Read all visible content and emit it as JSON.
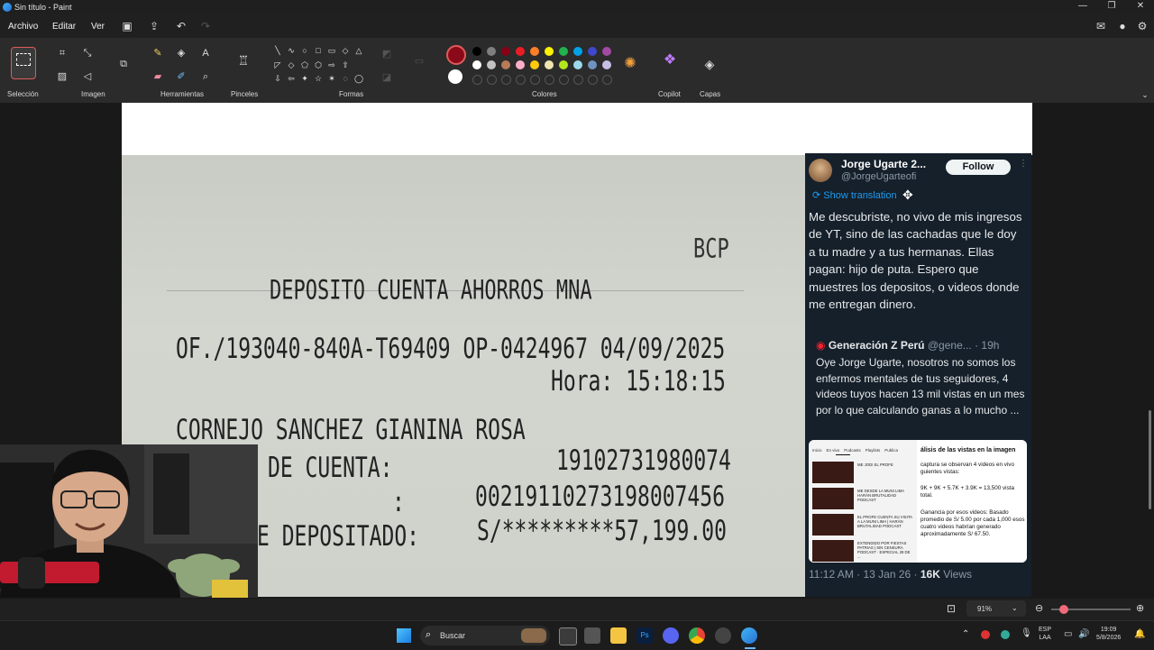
{
  "window": {
    "title": "Sin título - Paint",
    "controls": [
      "—",
      "❐",
      "✕"
    ]
  },
  "menu": {
    "items": [
      "Archivo",
      "Editar",
      "Ver"
    ],
    "quick_icons": [
      "save-icon",
      "share-icon",
      "undo-icon",
      "redo-icon"
    ],
    "right_icons": [
      "feedback-icon",
      "account-icon",
      "settings-icon"
    ]
  },
  "ribbon": {
    "groups": {
      "seleccion": "Selección",
      "imagen": "Imagen",
      "herramientas": "Herramientas",
      "pinceles": "Pinceles",
      "formas": "Formas",
      "colores": "Colores",
      "copilot": "Copilot",
      "capas": "Capas"
    },
    "shape_glyphs": [
      "╲",
      "∿",
      "○",
      "□",
      "▭",
      "◇",
      "△",
      "◸",
      "◇",
      "⬠",
      "⬡",
      "⇨",
      "⇧",
      "⇩",
      "⇦",
      "✦",
      "☆",
      "✶",
      "◌",
      "◯",
      "◌"
    ],
    "colors": {
      "primary": "#8b0a1a",
      "secondary": "#ffffff",
      "palette_row1": [
        "#000000",
        "#7f7f7f",
        "#880015",
        "#ed1c24",
        "#ff7f27",
        "#fff200",
        "#22b14c",
        "#00a2e8",
        "#3f48cc",
        "#a349a4"
      ],
      "palette_row2": [
        "#ffffff",
        "#c3c3c3",
        "#b97a57",
        "#ffaec9",
        "#ffc90e",
        "#efe4b0",
        "#b5e61d",
        "#99d9ea",
        "#7092be",
        "#c8bfe7"
      ]
    }
  },
  "receipt": {
    "bank": "BCP",
    "title": "DEPOSITO CUENTA AHORROS MNA",
    "ref_line": "OF./193040-840A-T69409 OP-0424967 04/09/2025",
    "time_line": "Hora: 15:18:15",
    "name_line": "CORNEJO SANCHEZ GIANINA ROSA",
    "account_label": "DE CUENTA:",
    "account_number": "19102731980074",
    "cci_label": ":",
    "cci_number": "00219110273198007456",
    "amount_label": "E DEPOSITADO:",
    "amount_value": "S/*********57,199.00"
  },
  "tweet": {
    "name": "Jorge Ugarte 2...",
    "handle": "@JorgeUgarteofi",
    "follow_label": "Follow",
    "more": "⋮",
    "translate_label": "Show translation",
    "body": "Me descubriste, no vivo de mis ingresos de YT, sino de las cachadas que le doy a tu madre y a tus hermanas. Ellas pagan: hijo de puta. Espero que muestres los depositos, o videos donde me entregan dinero.",
    "quote": {
      "name": "Generación Z Perú",
      "handle": "@gene...",
      "time": "· 19h",
      "body": "Oye Jorge Ugarte, nosotros no somos los enfermos mentales de tus seguidores, 4 videos tuyos hacen 13 mil vistas en un mes por lo que calculando ganas a lo mucho ...",
      "image_left_tabs": "Inicio    En vivo    Podcasts    Playlists    Publica",
      "image_video_titles": [
        "ME JODI EL PROFE",
        "ME DESDE LA MUNI LIMA HARÁN BRUTALIDAD PODCAST",
        "EL PROFE CUENTA SU VISITA A LA MUNI LIMA | HARÁN BRUTALIDAD PODCAST",
        "EXTENDIDO POR FIESTAS PATRIAS | SIN CENSURA PODCAST · ESPECIAL 28 DE ..."
      ],
      "image_right_title": "álisis de las vistas en la imagen",
      "image_right_p1": "captura se observan 4 videos en vivo guientes vistas:",
      "image_right_p2": "9K + 9K + 5.7K + 3.9K = 13,500 vista total.",
      "image_right_p3": "Ganancia por esos videos: Basado promedio de S/ 5.00 por cada 1,000 esos cuatro videos habrían generado aproximadamente S/ 67.50."
    },
    "time": "11:12 AM · 13 Jan 26 ·",
    "views_count": "16K",
    "views_label": "Views"
  },
  "statusbar": {
    "zoom": "91%",
    "zoom_fraction": 0.1
  },
  "taskbar": {
    "search_placeholder": "Buscar",
    "lang_1": "ESP",
    "lang_2": "LAA",
    "clock_time": "19:09",
    "clock_date": "5/8/2026"
  }
}
